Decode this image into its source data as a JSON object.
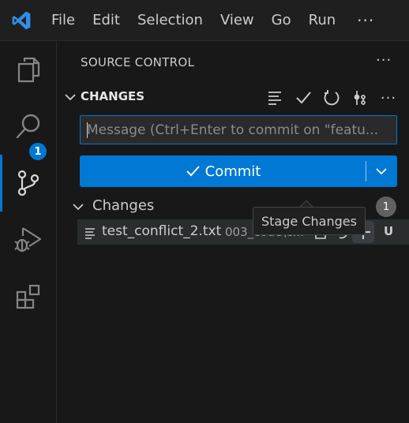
{
  "menu": {
    "items": [
      "File",
      "Edit",
      "Selection",
      "View",
      "Go",
      "Run"
    ],
    "more": "···"
  },
  "activity_bar": {
    "items": [
      "explorer-icon",
      "search-icon",
      "source-control-icon",
      "run-debug-icon",
      "extensions-icon"
    ],
    "active": "source-control-icon",
    "badge": "1"
  },
  "sidebar": {
    "view_title": "SOURCE CONTROL",
    "view_more": "···",
    "section_title": "CHANGES",
    "header_actions": [
      "view-as-list-icon",
      "commit-check-icon",
      "refresh-icon",
      "graph-icon",
      "more-icon"
    ],
    "message_placeholder": "Message (Ctrl+Enter to commit on \"featu...",
    "commit_label": "Commit",
    "group": {
      "label": "Changes",
      "count": "1"
    },
    "files": [
      {
        "name": "test_conflict_2.txt",
        "path": "003_code\\c...",
        "status": "U",
        "actions": [
          "open-file-icon",
          "discard-changes-icon",
          "stage-changes-icon"
        ]
      }
    ],
    "tooltip": "Stage Changes"
  },
  "colors": {
    "accent": "#0078d4",
    "background": "#181818",
    "row_hover": "#2a2d2e"
  }
}
